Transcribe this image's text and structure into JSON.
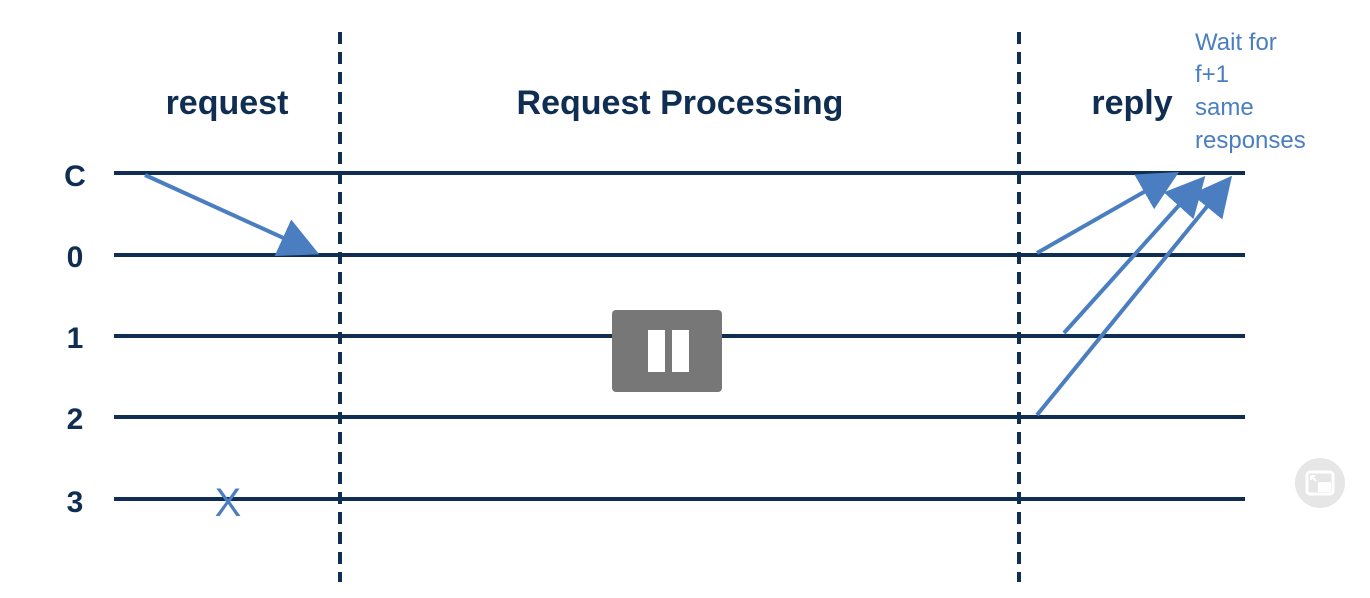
{
  "diagram": {
    "phases": {
      "request": "request",
      "processing": "Request Processing",
      "reply": "reply"
    },
    "rows": [
      "C",
      "0",
      "1",
      "2",
      "3"
    ],
    "crash_mark": "X",
    "note_lines": [
      "Wait for",
      "f+1",
      "same",
      "responses"
    ],
    "colors": {
      "line": "#0f2e52",
      "arrow": "#4a7ec0",
      "note": "#4a7ec0"
    }
  },
  "controls": {
    "pause_icon": "pause-icon",
    "pip_icon": "picture-in-picture-icon"
  }
}
